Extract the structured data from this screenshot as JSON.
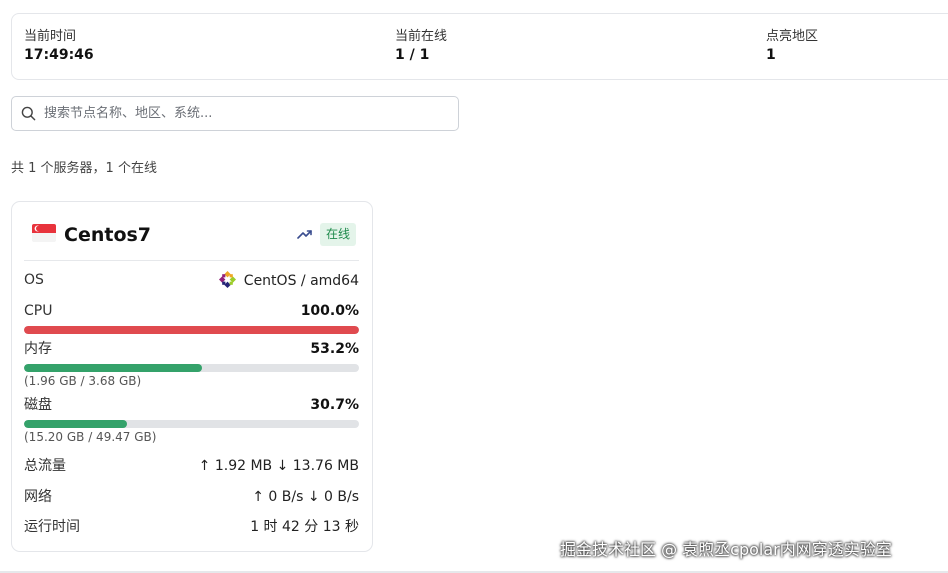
{
  "stats": {
    "current_time_label": "当前时间",
    "current_time_value": "17:49:46",
    "online_label": "当前在线",
    "online_value": "1 / 1",
    "regions_label": "点亮地区",
    "regions_value": "1"
  },
  "search": {
    "placeholder": "搜索节点名称、地区、系统...",
    "icon": "search-icon"
  },
  "summary": "共 1 个服务器，1 个在线",
  "server": {
    "flag": "singapore-flag",
    "name": "Centos7",
    "status": "在线",
    "status_color": "#1f8a4c",
    "os_label": "OS",
    "os_value": "CentOS / amd64",
    "cpu_label": "CPU",
    "cpu_value": "100.0%",
    "cpu_fraction": 1.0,
    "cpu_color": "#e04a4f",
    "mem_label": "内存",
    "mem_value": "53.2%",
    "mem_fraction": 0.532,
    "mem_detail": "(1.96 GB / 3.68 GB)",
    "mem_color": "#34a26a",
    "disk_label": "磁盘",
    "disk_value": "30.7%",
    "disk_fraction": 0.307,
    "disk_detail": "(15.20 GB / 49.47 GB)",
    "disk_color": "#34a26a",
    "traffic_label": "总流量",
    "traffic_value": "↑ 1.92 MB ↓ 13.76 MB",
    "network_label": "网络",
    "network_value": "↑ 0 B/s ↓ 0 B/s",
    "uptime_label": "运行时间",
    "uptime_value": "1 时 42 分 13 秒"
  },
  "watermark": "掘金技术社区 @ 袁煦丞cpolar内网穿透实验室"
}
